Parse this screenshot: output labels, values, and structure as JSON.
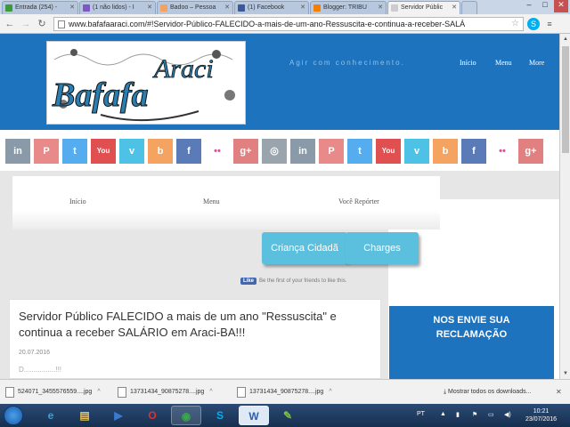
{
  "browser": {
    "tabs": [
      {
        "label": "Entrada (254) - ",
        "favicon_color": "#3a9b3a",
        "active": false
      },
      {
        "label": "(1 não lidos) - I",
        "favicon_color": "#7e57c2",
        "active": false
      },
      {
        "label": "Badoo – Pessoa",
        "favicon_color": "#f4a261",
        "active": false
      },
      {
        "label": "(1) Facebook",
        "favicon_color": "#3b5998",
        "active": false
      },
      {
        "label": "Blogger: TRIBU",
        "favicon_color": "#f57d00",
        "active": false
      },
      {
        "label": "Servidor Públic",
        "favicon_color": "#cccccc",
        "active": true
      }
    ],
    "url": "www.bafafaaraci.com/#!Servidor-Público-FALECIDO-a-mais-de-um-ano-Ressuscita-e-continua-a-receber-SALÁ",
    "window_controls": [
      "–",
      "□",
      "✕"
    ]
  },
  "site": {
    "logo_text": "Bafafa Araci",
    "tagline": "Agir com conhecimento.",
    "top_nav": [
      "Início",
      "Menu",
      "More"
    ],
    "social_icons": [
      {
        "label": "in",
        "name": "linkedin-icon",
        "color": "#8a9aa8"
      },
      {
        "label": "P",
        "name": "pinterest-icon",
        "color": "#e98a8a"
      },
      {
        "label": "t",
        "name": "twitter-icon",
        "color": "#55acee"
      },
      {
        "label": "You",
        "name": "youtube-icon",
        "color": "#e05050"
      },
      {
        "label": "v",
        "name": "vimeo-icon",
        "color": "#4ec1e7"
      },
      {
        "label": "b",
        "name": "blogger-icon",
        "color": "#f4a460"
      },
      {
        "label": "f",
        "name": "facebook-icon",
        "color": "#5b7bb8"
      },
      {
        "label": "••",
        "name": "flickr-icon",
        "color": "#ffffff"
      },
      {
        "label": "g+",
        "name": "googleplus-icon",
        "color": "#e08080"
      },
      {
        "label": "◎",
        "name": "instagram-icon",
        "color": "#9aa4ad"
      }
    ],
    "menu": [
      "Início",
      "Menu",
      "Você Repórter"
    ],
    "buttons": [
      "Criança Cidadã",
      "Charges"
    ],
    "facebook_like": {
      "button": "Like",
      "text": "Be the first of your friends to like this."
    },
    "post": {
      "title": "Servidor Público FALECIDO a mais de um ano \"Ressuscita\" e continua a receber SALÁRIO em Araci-BA!!!",
      "date": "20.07.2016",
      "snippet": "D................!!!"
    },
    "widget_title": "NOS ENVIE SUA RECLAMAÇÃO"
  },
  "downloads": {
    "items": [
      "524071_3455576559....jpg",
      "13731434_90875278....jpg",
      "13731434_90875278....jpg"
    ],
    "show_all": "Mostrar todos os downloads...",
    "close": "✕"
  },
  "taskbar": {
    "apps": [
      {
        "name": "ie-icon",
        "glyph": "e",
        "color": "#3aa0e0",
        "active": false
      },
      {
        "name": "explorer-icon",
        "glyph": "▤",
        "color": "#e8c15a",
        "active": false
      },
      {
        "name": "media-player-icon",
        "glyph": "▶",
        "color": "#3a7ad0",
        "active": false
      },
      {
        "name": "opera-icon",
        "glyph": "O",
        "color": "#e03030",
        "active": false
      },
      {
        "name": "chrome-icon",
        "glyph": "◉",
        "color": "#3aa84a",
        "active": true
      },
      {
        "name": "skype-icon",
        "glyph": "S",
        "color": "#00aff0",
        "active": false
      },
      {
        "name": "word-icon",
        "glyph": "W",
        "color": "#2b5faa",
        "active": true
      },
      {
        "name": "sketch-app-icon",
        "glyph": "✎",
        "color": "#7ac142",
        "active": false
      }
    ],
    "language": "PT",
    "time": "10:21",
    "date": "23/07/2016"
  }
}
